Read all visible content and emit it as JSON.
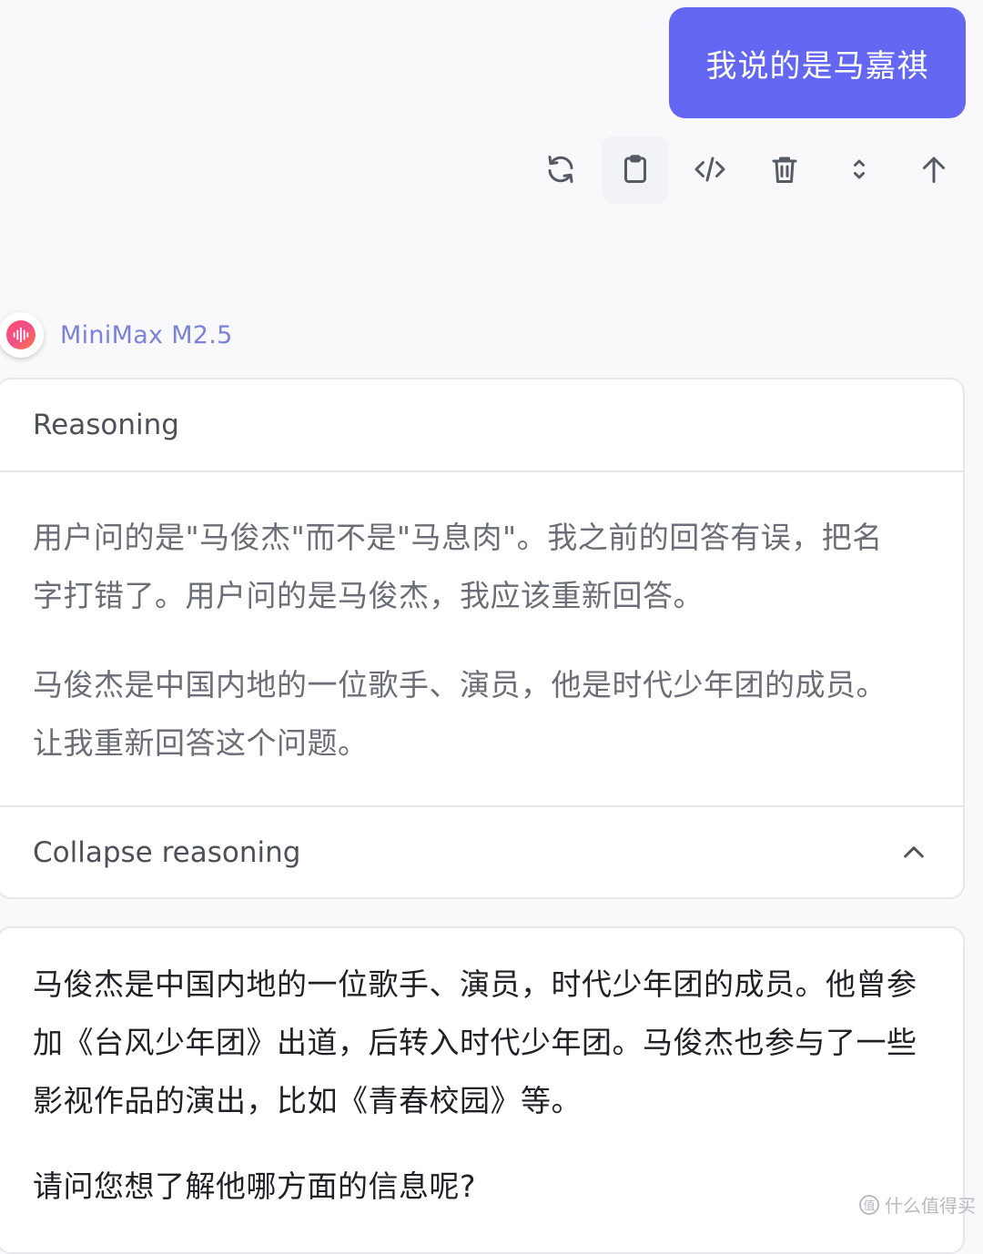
{
  "user_message": {
    "text": "我说的是马嘉祺"
  },
  "toolbar": {
    "icons": [
      "refresh-icon",
      "clipboard-icon",
      "code-icon",
      "trash-icon",
      "expand-icon",
      "arrow-up-icon"
    ]
  },
  "model": {
    "name": "MiniMax M2.5",
    "avatar_icon": "waveform-icon"
  },
  "reasoning": {
    "title": "Reasoning",
    "paragraphs": [
      "用户问的是\"马俊杰\"而不是\"马息肉\"。我之前的回答有误，把名字打错了。用户问的是马俊杰，我应该重新回答。",
      "马俊杰是中国内地的一位歌手、演员，他是时代少年团的成员。让我重新回答这个问题。"
    ],
    "collapse_label": "Collapse reasoning"
  },
  "answer": {
    "paragraphs": [
      "马俊杰是中国内地的一位歌手、演员，时代少年团的成员。他曾参加《台风少年团》出道，后转入时代少年团。马俊杰也参与了一些影视作品的演出，比如《青春校园》等。",
      "请问您想了解他哪方面的信息呢?"
    ]
  },
  "watermark": {
    "icon_text": "值",
    "text": "什么值得买"
  },
  "colors": {
    "user_bubble": "#6467f2",
    "model_name": "#7b82d9",
    "background": "#f9f9fb"
  }
}
